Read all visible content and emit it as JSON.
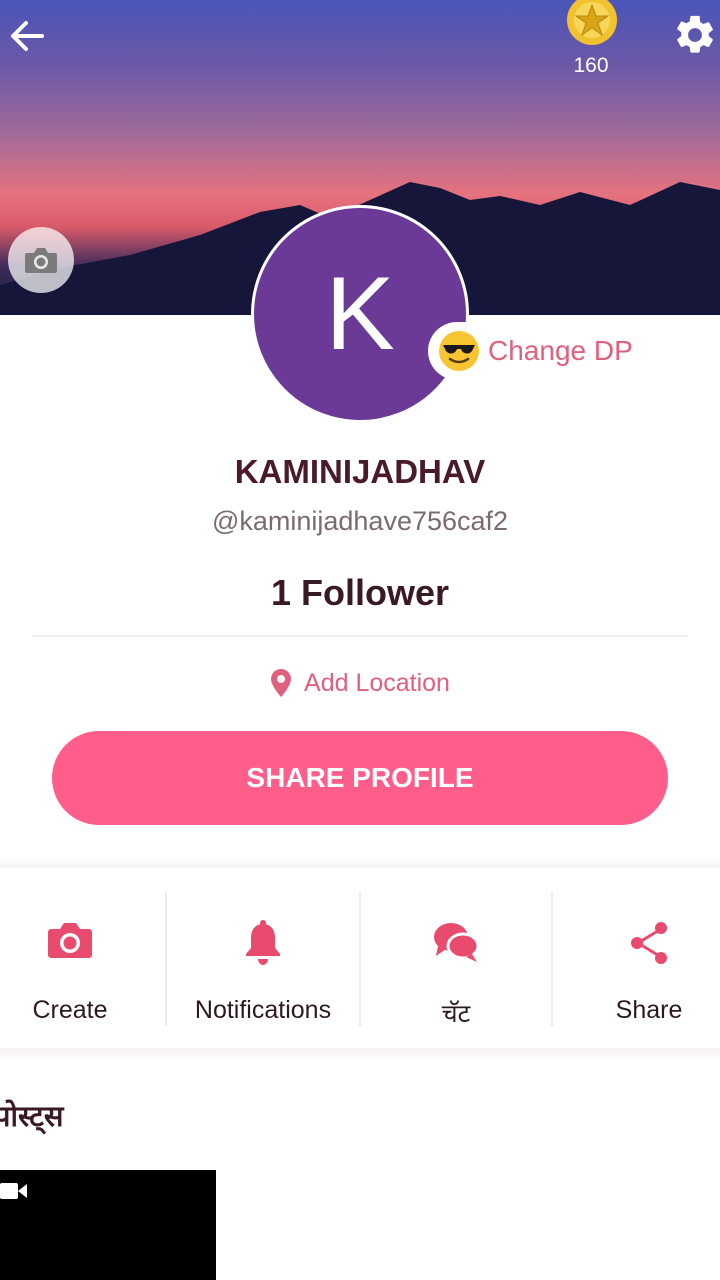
{
  "header": {
    "coins": "160"
  },
  "profile": {
    "avatar_letter": "K",
    "change_dp_label": "Change DP",
    "name": "KAMINIJADHAV",
    "handle": "@kaminijadhave756caf2",
    "followers": "1 Follower",
    "location_label": "Add Location",
    "share_profile_label": "SHARE PROFILE"
  },
  "actions": [
    {
      "label": "Create",
      "icon": "camera-icon"
    },
    {
      "label": "Notifications",
      "icon": "bell-icon"
    },
    {
      "label": "चॅट",
      "icon": "chat-icon"
    },
    {
      "label": "Share",
      "icon": "share-icon"
    }
  ],
  "posts": {
    "title": "पोस्ट्स"
  },
  "colors": {
    "accent": "#ff5e8a",
    "accent_text": "#e0607e",
    "avatar_bg": "#6a3a96",
    "name_text": "#4a1a26"
  }
}
